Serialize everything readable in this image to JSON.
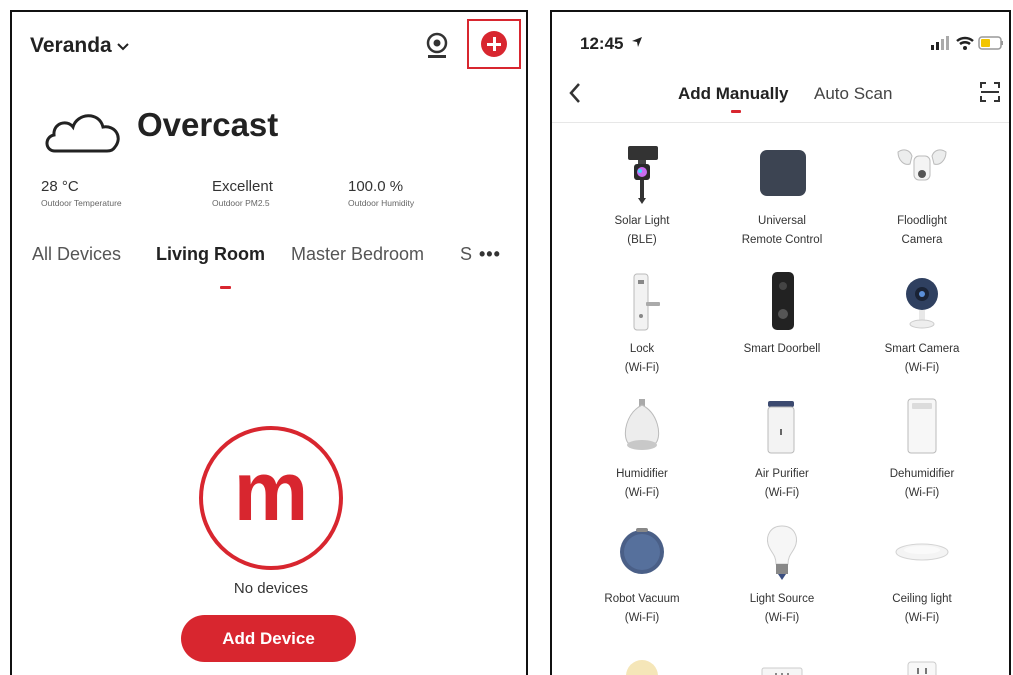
{
  "left_screen": {
    "home_name": "Veranda",
    "weather": {
      "condition": "Overcast"
    },
    "stats": [
      {
        "value": "28 °C",
        "label": "Outdoor Temperature"
      },
      {
        "value": "Excellent",
        "label": "Outdoor PM2.5"
      },
      {
        "value": "100.0 %",
        "label": "Outdoor Humidity"
      }
    ],
    "room_tabs": [
      {
        "label": "All Devices",
        "active": false
      },
      {
        "label": "Living Room",
        "active": true
      },
      {
        "label": "Master Bedroom",
        "active": false
      },
      {
        "label": "S",
        "active": false
      }
    ],
    "more_label": "•••",
    "logo_letter": "m",
    "empty_text": "No devices",
    "add_device_label": "Add Device",
    "colors": {
      "accent": "#d8262f"
    }
  },
  "right_screen": {
    "status_time": "12:45",
    "nav_tabs": [
      {
        "label": "Add Manually",
        "active": true
      },
      {
        "label": "Auto Scan",
        "active": false
      }
    ],
    "devices": [
      {
        "name": "Solar Light",
        "sub": "(BLE)",
        "icon": "solar-light-icon"
      },
      {
        "name": "Universal",
        "sub": "Remote Control",
        "icon": "universal-remote-icon"
      },
      {
        "name": "Floodlight",
        "sub": "Camera",
        "icon": "floodlight-camera-icon"
      },
      {
        "name": "Lock",
        "sub": "(Wi-Fi)",
        "icon": "lock-icon"
      },
      {
        "name": "Smart Doorbell",
        "sub": "",
        "icon": "smart-doorbell-icon"
      },
      {
        "name": "Smart Camera",
        "sub": "(Wi-Fi)",
        "icon": "smart-camera-icon"
      },
      {
        "name": "Humidifier",
        "sub": "(Wi-Fi)",
        "icon": "humidifier-icon"
      },
      {
        "name": "Air Purifier",
        "sub": "(Wi-Fi)",
        "icon": "air-purifier-icon"
      },
      {
        "name": "Dehumidifier",
        "sub": "(Wi-Fi)",
        "icon": "dehumidifier-icon"
      },
      {
        "name": "Robot Vacuum",
        "sub": "(Wi-Fi)",
        "icon": "robot-vacuum-icon"
      },
      {
        "name": "Light Source",
        "sub": "(Wi-Fi)",
        "icon": "light-source-icon"
      },
      {
        "name": "Ceiling light",
        "sub": "(Wi-Fi)",
        "icon": "ceiling-light-icon"
      }
    ]
  }
}
